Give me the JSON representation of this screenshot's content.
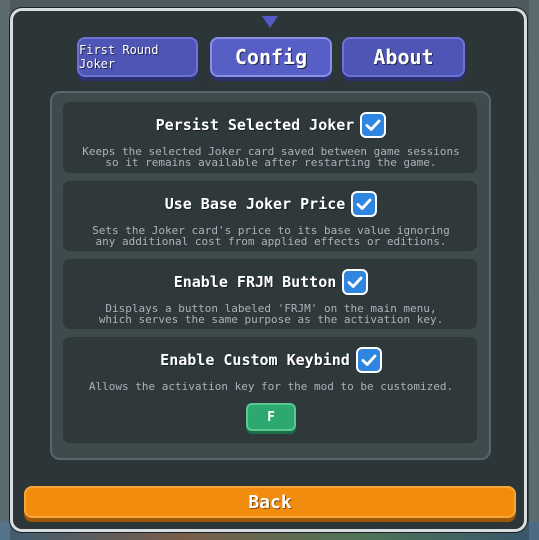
{
  "tabs": [
    {
      "label": "First Round Joker",
      "active": false
    },
    {
      "label": "Config",
      "active": true
    },
    {
      "label": "About",
      "active": false
    }
  ],
  "options": [
    {
      "title": "Persist Selected Joker",
      "checked": true,
      "desc_line1": "Keeps the selected Joker card saved between game sessions",
      "desc_line2": "so it remains available after restarting the game."
    },
    {
      "title": "Use Base Joker Price",
      "checked": true,
      "desc_line1": "Sets the Joker card's price to its base value ignoring",
      "desc_line2": "any additional cost from applied effects or editions."
    },
    {
      "title": "Enable FRJM Button",
      "checked": true,
      "desc_line1": "Displays a button labeled 'FRJM' on the main menu,",
      "desc_line2": "which serves the same purpose as the activation key."
    },
    {
      "title": "Enable Custom Keybind",
      "checked": true,
      "desc_line1": "Allows the activation key for the mod to be customized.",
      "keybind": "F"
    }
  ],
  "back_label": "Back",
  "colors": {
    "tab": "#4e55b4",
    "checkbox": "#2f86e0",
    "keybind": "#2da86f",
    "back": "#f28c0f"
  },
  "icons": {
    "checkbox": "checkmark-icon",
    "caret": "caret-down-icon"
  }
}
